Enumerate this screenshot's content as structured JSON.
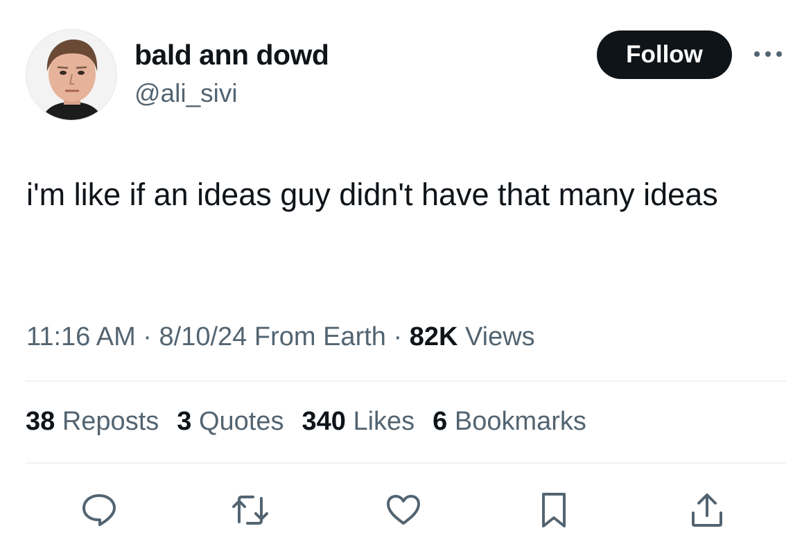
{
  "author": {
    "display_name": "bald ann dowd",
    "handle": "@ali_sivi",
    "avatar_icon": "profile-photo"
  },
  "header": {
    "follow_label": "Follow",
    "more_icon": "more-dots-icon"
  },
  "tweet": {
    "text": "i'm like if an ideas guy didn't have that many ideas"
  },
  "meta": {
    "time": "11:16 AM",
    "separator": "·",
    "date": "8/10/24",
    "source": "From Earth",
    "views_count": "82K",
    "views_label": "Views"
  },
  "stats": {
    "reposts_count": "38",
    "reposts_label": "Reposts",
    "quotes_count": "3",
    "quotes_label": "Quotes",
    "likes_count": "340",
    "likes_label": "Likes",
    "bookmarks_count": "6",
    "bookmarks_label": "Bookmarks"
  },
  "actions": {
    "icons": [
      "reply-icon",
      "repost-icon",
      "like-icon",
      "bookmark-icon",
      "share-icon"
    ],
    "icon_color": "#536471"
  },
  "colors": {
    "text_primary": "#0f1419",
    "text_secondary": "#536471",
    "follow_bg": "#0f1419",
    "divider": "#eff3f4"
  }
}
